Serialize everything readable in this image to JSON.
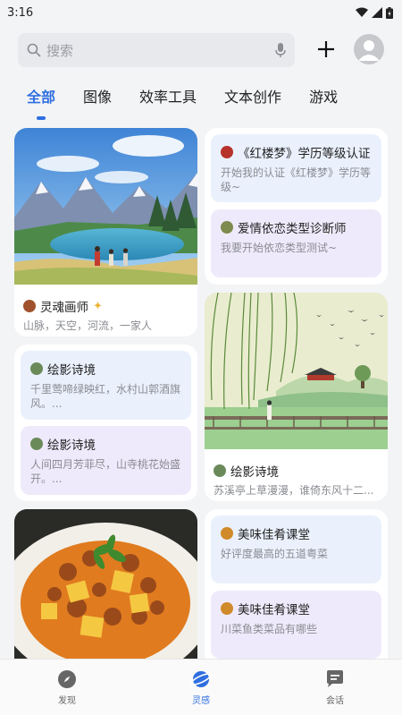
{
  "status": {
    "time": "3:16"
  },
  "search": {
    "placeholder": "搜索"
  },
  "tabs": [
    {
      "label": "全部",
      "active": true
    },
    {
      "label": "图像"
    },
    {
      "label": "效率工具"
    },
    {
      "label": "文本创作"
    },
    {
      "label": "游戏"
    }
  ],
  "cards": {
    "painter": {
      "title": "灵魂画师",
      "desc": "山脉，天空，河流，一家人"
    },
    "study": {
      "items": [
        {
          "title": "《红楼梦》学历等级认证",
          "desc": "开始我的认证《红楼梦》学历等级~"
        },
        {
          "title": "爱情依恋类型诊断师",
          "desc": "我要开始依恋类型测试~"
        }
      ]
    },
    "poem_list": {
      "items": [
        {
          "title": "绘影诗境",
          "desc": "千里莺啼绿映红，水村山郭酒旗风。..."
        },
        {
          "title": "绘影诗境",
          "desc": "人间四月芳菲尽，山寺桃花始盛开。..."
        }
      ]
    },
    "poem_image": {
      "title": "绘影诗境",
      "desc": "苏溪亭上草漫漫，谁倚东风十二..."
    },
    "food": {
      "items": [
        {
          "title": "美味佳肴课堂",
          "desc": "好评度最高的五道粤菜"
        },
        {
          "title": "美味佳肴课堂",
          "desc": "川菜鱼类菜品有哪些"
        }
      ]
    }
  },
  "nav": [
    {
      "label": "发现",
      "icon": "compass-icon"
    },
    {
      "label": "灵感",
      "icon": "planet-icon",
      "active": true
    },
    {
      "label": "会话",
      "icon": "chat-icon"
    }
  ],
  "colors": {
    "accent": "#2f6fe0",
    "blue_card": "#eaf1fd",
    "purple_card": "#efeafb"
  }
}
